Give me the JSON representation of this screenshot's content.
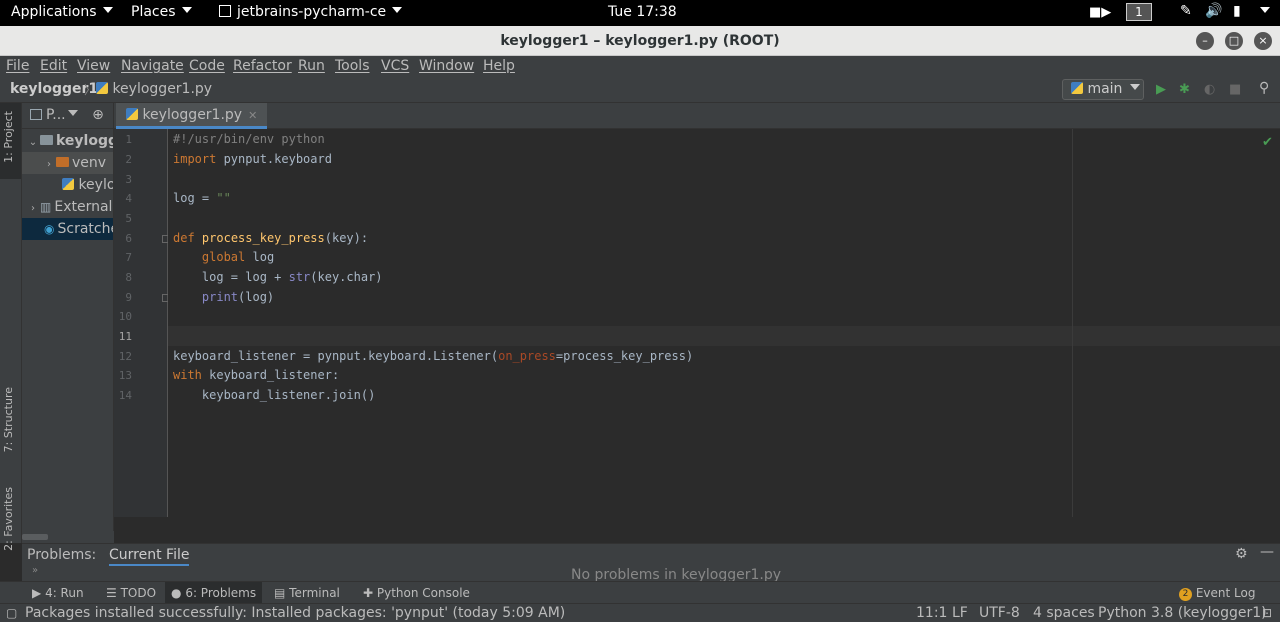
{
  "topbar": {
    "applications": "Applications",
    "places": "Places",
    "app_name": "jetbrains-pycharm-ce",
    "clock": "Tue 17:38",
    "workspace": "1"
  },
  "window": {
    "title": "keylogger1 – keylogger1.py (ROOT)"
  },
  "menu": [
    "File",
    "Edit",
    "View",
    "Navigate",
    "Code",
    "Refactor",
    "Run",
    "Tools",
    "VCS",
    "Window",
    "Help"
  ],
  "navbar": {
    "project": "keylogger1",
    "file": "keylogger1.py",
    "run_config": "main"
  },
  "leftstrip": {
    "project_tab": "1: Project",
    "structure_tab": "7: Structure",
    "favorites_tab": "2: Favorites"
  },
  "project_panel": {
    "header": "P...",
    "items": [
      {
        "label": "keylogg"
      },
      {
        "label": "venv"
      },
      {
        "label": "keylog"
      },
      {
        "label": "External"
      },
      {
        "label": "Scratche"
      }
    ]
  },
  "editor": {
    "tab_label": "keylogger1.py",
    "line_numbers": [
      "1",
      "2",
      "3",
      "4",
      "5",
      "6",
      "7",
      "8",
      "9",
      "10",
      "11",
      "12",
      "13",
      "14"
    ]
  },
  "problems": {
    "title": "Problems:",
    "tab": "Current File",
    "message": "No problems in keylogger1.py"
  },
  "toolwindows": {
    "run": "4: Run",
    "todo": "TODO",
    "problems": "6: Problems",
    "terminal": "Terminal",
    "python_console": "Python Console",
    "event_log": "Event Log",
    "event_count": "2"
  },
  "statusbar": {
    "message": "Packages installed successfully: Installed packages: 'pynput' (today 5:09 AM)",
    "position": "11:1",
    "line_sep": "LF",
    "encoding": "UTF-8",
    "indent": "4 spaces",
    "interpreter": "Python 3.8 (keylogger1)"
  },
  "colors": {
    "accent": "#4a88c7",
    "keyword": "#cc7832",
    "string": "#6a8759",
    "function": "#ffc66d",
    "builtin": "#8888c6"
  }
}
